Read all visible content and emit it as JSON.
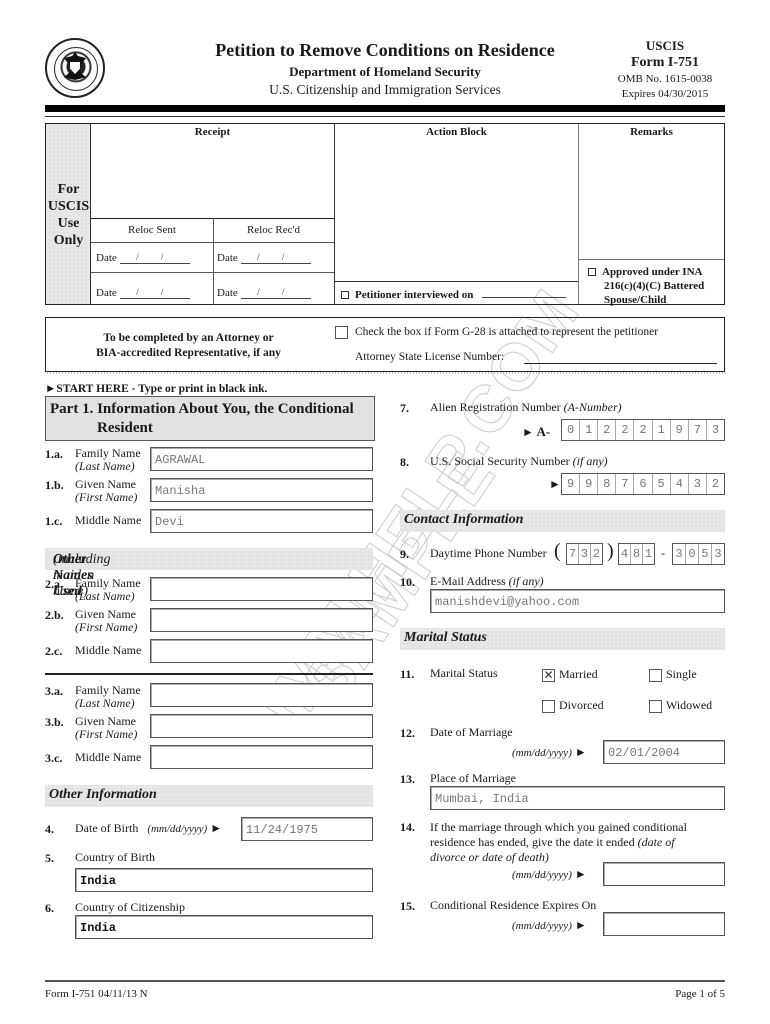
{
  "header": {
    "seal_alt": "U.S. Department of Homeland Security seal",
    "title": "Petition to Remove Conditions on Residence",
    "department": "Department of Homeland Security",
    "agency": "U.S. Citizenship and Immigration Services",
    "agency_short": "USCIS",
    "form_number": "Form I-751",
    "omb": "OMB No. 1615-0038",
    "expires": "Expires 04/30/2015"
  },
  "uscis_block": {
    "side_label": [
      "For",
      "USCIS",
      "Use",
      "Only"
    ],
    "receipt": "Receipt",
    "action_block": "Action Block",
    "remarks": "Remarks",
    "reloc_sent": "Reloc Sent",
    "reloc_recd": "Reloc Rec'd",
    "date_label": "Date",
    "date_slashes": "/ /",
    "petitioner_interviewed": "Petitioner interviewed on",
    "approved_line1": "Approved under INA",
    "approved_line2": "216(c)(4)(C) Battered",
    "approved_line3": "Spouse/Child"
  },
  "attorney": {
    "line1": "To be completed by an Attorney or",
    "line2": "BIA-accredited Representative, if any",
    "g28_check_label": "Check the box if Form G-28 is attached to represent the petitioner",
    "g28_checked": false,
    "license_label": "Attorney State License Number:",
    "license_value": ""
  },
  "start_here": "START HERE - Type or print in black ink.",
  "part1": {
    "title_line1": "Part 1. Information About You, the Conditional",
    "title_line2": "Resident",
    "family_name_num": "1.a.",
    "family_name_label": "Family Name",
    "family_name_sub": "(Last Name)",
    "family_name": "AGRAWAL",
    "given_name_num": "1.b.",
    "given_name_label": "Given Name",
    "given_name_sub": "(First Name)",
    "given_name": "Manisha",
    "middle_name_num": "1.c.",
    "middle_name_label": "Middle Name",
    "middle_name": "Devi"
  },
  "other_names": {
    "heading": "Other Names Used",
    "heading_sub": "(including maiden name)",
    "set2": {
      "family_num": "2.a.",
      "family_label": "Family Name",
      "family_sub": "(Last Name)",
      "family_value": "",
      "given_num": "2.b.",
      "given_label": "Given Name",
      "given_sub": "(First Name)",
      "given_value": "",
      "middle_num": "2.c.",
      "middle_label": "Middle Name",
      "middle_value": ""
    },
    "set3": {
      "family_num": "3.a.",
      "family_label": "Family Name",
      "family_sub": "(Last Name)",
      "family_value": "",
      "given_num": "3.b.",
      "given_label": "Given Name",
      "given_sub": "(First Name)",
      "given_value": "",
      "middle_num": "3.c.",
      "middle_label": "Middle Name",
      "middle_value": ""
    }
  },
  "other_info": {
    "heading": "Other Information",
    "dob_num": "4.",
    "dob_label": "Date of Birth",
    "date_format": "(mm/dd/yyyy)",
    "dob": "11/24/1975",
    "cob_num": "5.",
    "cob_label": "Country of Birth",
    "cob": "India",
    "coc_num": "6.",
    "coc_label": "Country of Citizenship",
    "coc": "India"
  },
  "right_col": {
    "a_num_num": "7.",
    "a_num_label": "Alien Registration Number",
    "a_num_sub": "(A-Number)",
    "a_prefix": "A-",
    "a_number": [
      "0",
      "1",
      "2",
      "2",
      "2",
      "1",
      "9",
      "7",
      "3"
    ],
    "ssn_num": "8.",
    "ssn_label": "U.S. Social Security Number",
    "ssn_sub": "(if any)",
    "ssn": [
      "9",
      "9",
      "8",
      "7",
      "6",
      "5",
      "4",
      "3",
      "2"
    ],
    "contact_heading": "Contact Information",
    "phone_num": "9.",
    "phone_label": "Daytime Phone Number",
    "phone_area": [
      "7",
      "3",
      "2"
    ],
    "phone_prefix": [
      "4",
      "8",
      "1"
    ],
    "phone_line": [
      "3",
      "0",
      "5",
      "3"
    ],
    "email_num": "10.",
    "email_label": "E-Mail Address",
    "email_sub": "(if any)",
    "email": "manishdevi@yahoo.com",
    "marital_heading": "Marital Status",
    "marital_num": "11.",
    "marital_label": "Marital Status",
    "marital_options": [
      {
        "label": "Married",
        "checked": true
      },
      {
        "label": "Single",
        "checked": false
      },
      {
        "label": "Divorced",
        "checked": false
      },
      {
        "label": "Widowed",
        "checked": false
      }
    ],
    "check_mark": "✕",
    "dom_num": "12.",
    "dom_label": "Date of Marriage",
    "date_format": "(mm/dd/yyyy)",
    "dom": "02/01/2004",
    "pom_num": "13.",
    "pom_label": "Place of Marriage",
    "pom": "Mumbai, India",
    "ended_num": "14.",
    "ended_line1": "If the marriage through which you gained conditional",
    "ended_line2a": "residence has ended, give the date it ended",
    "ended_line2b": "(date of",
    "ended_line3": "divorce or date of death)",
    "ended_value": "",
    "expires_num": "15.",
    "expires_label": "Conditional Residence Expires On",
    "expires_value": ""
  },
  "watermark": {
    "line1": "IMMIHELP.COM",
    "line2": "SAMPLE"
  },
  "footer": {
    "left": "Form I-751 04/11/13  N",
    "right": "Page 1 of 5"
  },
  "glyphs": {
    "arrow": "►",
    "paren_open": "(",
    "paren_close": ")",
    "dash": "-"
  }
}
